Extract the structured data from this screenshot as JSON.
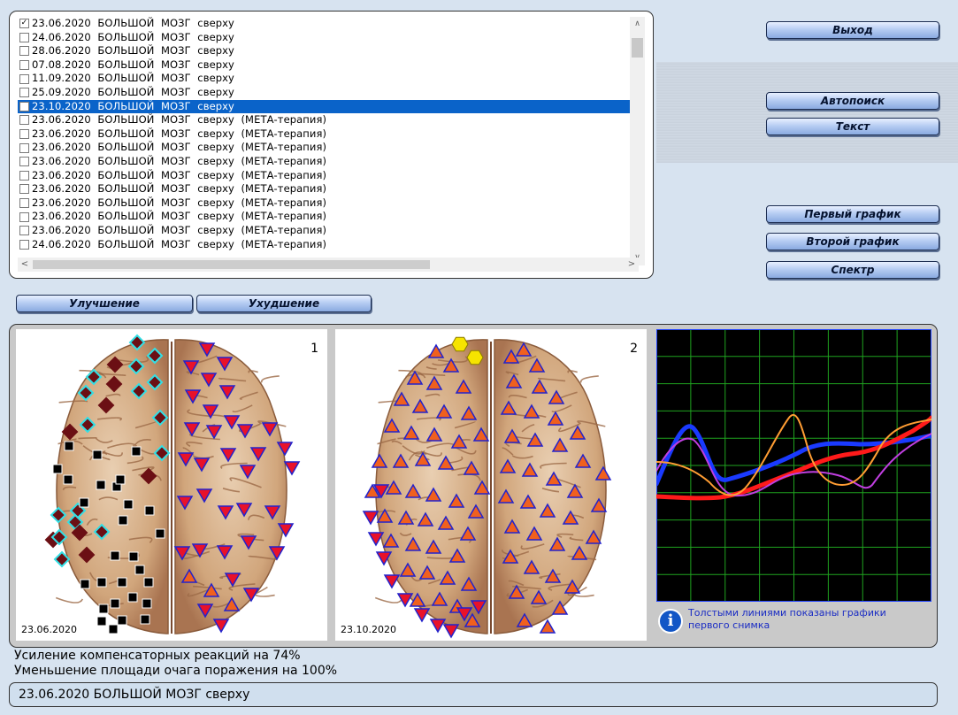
{
  "list": {
    "items": [
      {
        "label": "23.06.2020  БОЛЬШОЙ  МОЗГ  сверху",
        "checked": true,
        "selected": false
      },
      {
        "label": "24.06.2020  БОЛЬШОЙ  МОЗГ  сверху",
        "checked": false,
        "selected": false
      },
      {
        "label": "28.06.2020  БОЛЬШОЙ  МОЗГ  сверху",
        "checked": false,
        "selected": false
      },
      {
        "label": "07.08.2020  БОЛЬШОЙ  МОЗГ  сверху",
        "checked": false,
        "selected": false
      },
      {
        "label": "11.09.2020  БОЛЬШОЙ  МОЗГ  сверху",
        "checked": false,
        "selected": false
      },
      {
        "label": "25.09.2020  БОЛЬШОЙ  МОЗГ  сверху",
        "checked": false,
        "selected": false
      },
      {
        "label": "23.10.2020  БОЛЬШОЙ  МОЗГ  сверху",
        "checked": false,
        "selected": true
      },
      {
        "label": "23.06.2020  БОЛЬШОЙ  МОЗГ  сверху  (МЕТА-терапия)",
        "checked": false,
        "selected": false
      },
      {
        "label": "23.06.2020  БОЛЬШОЙ  МОЗГ  сверху  (МЕТА-терапия)",
        "checked": false,
        "selected": false
      },
      {
        "label": "23.06.2020  БОЛЬШОЙ  МОЗГ  сверху  (МЕТА-терапия)",
        "checked": false,
        "selected": false
      },
      {
        "label": "23.06.2020  БОЛЬШОЙ  МОЗГ  сверху  (МЕТА-терапия)",
        "checked": false,
        "selected": false
      },
      {
        "label": "23.06.2020  БОЛЬШОЙ  МОЗГ  сверху  (МЕТА-терапия)",
        "checked": false,
        "selected": false
      },
      {
        "label": "23.06.2020  БОЛЬШОЙ  МОЗГ  сверху  (МЕТА-терапия)",
        "checked": false,
        "selected": false
      },
      {
        "label": "23.06.2020  БОЛЬШОЙ  МОЗГ  сверху  (МЕТА-терапия)",
        "checked": false,
        "selected": false
      },
      {
        "label": "23.06.2020  БОЛЬШОЙ  МОЗГ  сверху  (МЕТА-терапия)",
        "checked": false,
        "selected": false
      },
      {
        "label": "23.06.2020  БОЛЬШОЙ  МОЗГ  сверху  (МЕТА-терапия)",
        "checked": false,
        "selected": false
      },
      {
        "label": "24.06.2020  БОЛЬШОЙ  МОЗГ  сверху  (МЕТА-терапия)",
        "checked": false,
        "selected": false
      }
    ],
    "scroll_up_icon": "chevron-up-icon",
    "scroll_down_icon": "chevron-down-icon",
    "scroll_left_icon": "chevron-left-icon",
    "scroll_right_icon": "chevron-right-icon",
    "selection_color": "#0a63c9"
  },
  "buttons": {
    "exit": "Выход",
    "autosearch": "Автопоиск",
    "text": "Текст",
    "first_graph": "Первый график",
    "second_graph": "Второй график",
    "spectrum": "Спектр",
    "improvement": "Улучшение",
    "deterioration": "Ухудшение"
  },
  "brains": [
    {
      "number": "1",
      "date": "23.06.2020"
    },
    {
      "number": "2",
      "date": "23.10.2020"
    }
  ],
  "markers": {
    "improvement_color": "#6b0f14",
    "improvement_outline": "#32e0e6",
    "neutral_color": "#000000",
    "down_color": "#e8122a",
    "up_color": "#f0601e",
    "outline_color": "#2222cc",
    "highlight_color": "#f6e400"
  },
  "graph": {
    "grid_color": "#1fa31f",
    "series_colors": [
      "#1a3aff",
      "#ff1a1a",
      "#c03fe0",
      "#ff9d33"
    ]
  },
  "info": {
    "icon": "info-icon",
    "text": "Толстыми линиями показаны графики первого снимка"
  },
  "results": {
    "line1": "Усиление компенсаторных реакций на 74%",
    "line2": "Уменьшение площади очага поражения на 100%"
  },
  "status": {
    "text": "23.06.2020 БОЛЬШОЙ  МОЗГ  сверху"
  }
}
